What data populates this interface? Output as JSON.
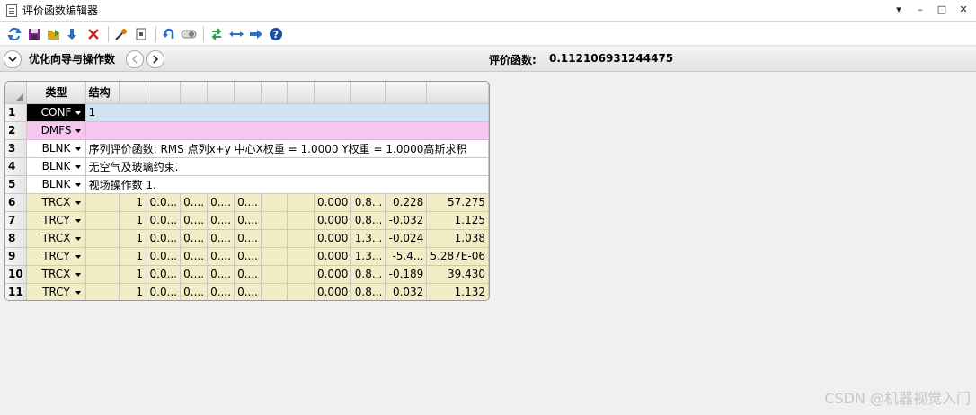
{
  "window": {
    "title": "评价函数编辑器",
    "controls": [
      "▾",
      "–",
      "□",
      "✕"
    ]
  },
  "toolbar": {
    "buttons": [
      {
        "name": "refresh-icon",
        "color": "#2a6fc4"
      },
      {
        "name": "save-icon",
        "color": "#7a2a8a"
      },
      {
        "name": "load-icon",
        "color": "#d4a81a"
      },
      {
        "name": "insert-row-icon",
        "color": "#2a6fc4"
      },
      {
        "name": "delete-icon",
        "color": "#d02020"
      },
      {
        "name": "wizard-icon",
        "color": "#d47a1a"
      },
      {
        "name": "operand-help-icon",
        "color": "#555555"
      },
      {
        "name": "undo-icon",
        "color": "#2a6fc4"
      },
      {
        "name": "toggle-icon",
        "color": "#808080"
      },
      {
        "name": "sync-icon",
        "color": "#2aa050"
      },
      {
        "name": "expand-arrows-icon",
        "color": "#2a6fc4"
      },
      {
        "name": "forward-arrow-icon",
        "color": "#2a6fc4"
      },
      {
        "name": "help-icon",
        "color": "#1a4fa0"
      }
    ]
  },
  "optbar": {
    "label": "优化向导与操作数",
    "merit_label": "评价函数:",
    "merit_value": "0.112106931244475"
  },
  "grid": {
    "headers": {
      "type": "类型",
      "structure": "结构"
    },
    "rows": [
      {
        "num": "1",
        "type": "CONF",
        "style": "conf",
        "text": "1"
      },
      {
        "num": "2",
        "type": "DMFS",
        "style": "dmfs",
        "text": ""
      },
      {
        "num": "3",
        "type": "BLNK",
        "style": "blnk",
        "text": "序列评价函数: RMS 点列x+y 中心X权重 = 1.0000 Y权重 = 1.0000高斯求积"
      },
      {
        "num": "4",
        "type": "BLNK",
        "style": "blnk",
        "text": "无空气及玻璃约束."
      },
      {
        "num": "5",
        "type": "BLNK",
        "style": "blnk",
        "text": "视场操作数 1."
      },
      {
        "num": "6",
        "type": "TRCX",
        "style": "op",
        "c": [
          "",
          "1",
          "0.0...",
          "0....",
          "0....",
          "0....",
          "",
          "",
          "0.000",
          "0.8...",
          "0.228",
          "57.275"
        ]
      },
      {
        "num": "7",
        "type": "TRCY",
        "style": "op",
        "c": [
          "",
          "1",
          "0.0...",
          "0....",
          "0....",
          "0....",
          "",
          "",
          "0.000",
          "0.8...",
          "-0.032",
          "1.125"
        ]
      },
      {
        "num": "8",
        "type": "TRCX",
        "style": "op",
        "c": [
          "",
          "1",
          "0.0...",
          "0....",
          "0....",
          "0....",
          "",
          "",
          "0.000",
          "1.3...",
          "-0.024",
          "1.038"
        ]
      },
      {
        "num": "9",
        "type": "TRCY",
        "style": "op",
        "c": [
          "",
          "1",
          "0.0...",
          "0....",
          "0....",
          "0....",
          "",
          "",
          "0.000",
          "1.3...",
          "-5.4...",
          "5.287E-06"
        ]
      },
      {
        "num": "10",
        "type": "TRCX",
        "style": "op",
        "c": [
          "",
          "1",
          "0.0...",
          "0....",
          "0....",
          "0....",
          "",
          "",
          "0.000",
          "0.8...",
          "-0.189",
          "39.430"
        ]
      },
      {
        "num": "11",
        "type": "TRCY",
        "style": "op",
        "c": [
          "",
          "1",
          "0.0...",
          "0....",
          "0....",
          "0....",
          "",
          "",
          "0.000",
          "0.8...",
          "0.032",
          "1.132"
        ]
      }
    ]
  },
  "watermark": "CSDN @机器视觉入门"
}
